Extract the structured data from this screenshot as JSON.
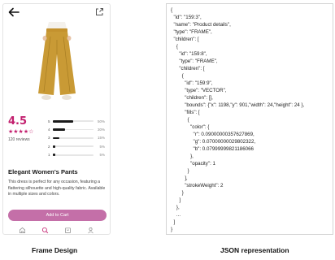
{
  "product": {
    "rating": "4.5",
    "stars": "★★★★☆",
    "reviews": "120 reviews",
    "title": "Elegant Women's Pants",
    "description": "This dress is perfect for any occasion, featuring a flattering silhouette and high-quality fabric. Available in multiple sizes and colors.",
    "add_to_cart_label": "Add to Cart",
    "accent_color": "#c21f6e",
    "button_color": "#c46fa8"
  },
  "rating_breakdown": [
    {
      "stars": "5",
      "percent_label": "50%",
      "fill": 0.5
    },
    {
      "stars": "4",
      "percent_label": "30%",
      "fill": 0.3
    },
    {
      "stars": "3",
      "percent_label": "15%",
      "fill": 0.15
    },
    {
      "stars": "2",
      "percent_label": "5%",
      "fill": 0.05
    },
    {
      "stars": "1",
      "percent_label": "5%",
      "fill": 0.05
    }
  ],
  "nav": [
    "home-icon",
    "search-icon",
    "bag-icon",
    "profile-icon"
  ],
  "json_lines": [
    "{",
    "  \"id\": \"159:3\",",
    "  \"name\": \"Product details\",",
    "  \"type\": \"FRAME\",",
    "  \"children\": [",
    "    {",
    "      \"id\": \"159:8\",",
    "      \"type\": \"FRAME\",",
    "      \"children\": [",
    "        {",
    "          \"id\": \"159:9\",",
    "          \"type\": \"VECTOR\",",
    "          \"children\": [],",
    "          \"bounds\": {\"x\": 1198,\"y\": 901,\"width\": 24,\"height\": 24 },",
    "          \"fills\": [",
    "            {",
    "              \"color\": {",
    "                \"r\": 0.09000000357627869,",
    "                \"g\": 0.07000000029802322,",
    "                \"b\": 0.07999999821186066",
    "              },",
    "              \"opacity\": 1",
    "            }",
    "          ],",
    "          \"strokeWeight\": 2",
    "        }",
    "      ]",
    "    },",
    "    ...",
    "  ]",
    "}"
  ],
  "captions": {
    "left": "Frame Design",
    "right": "JSON representation"
  }
}
